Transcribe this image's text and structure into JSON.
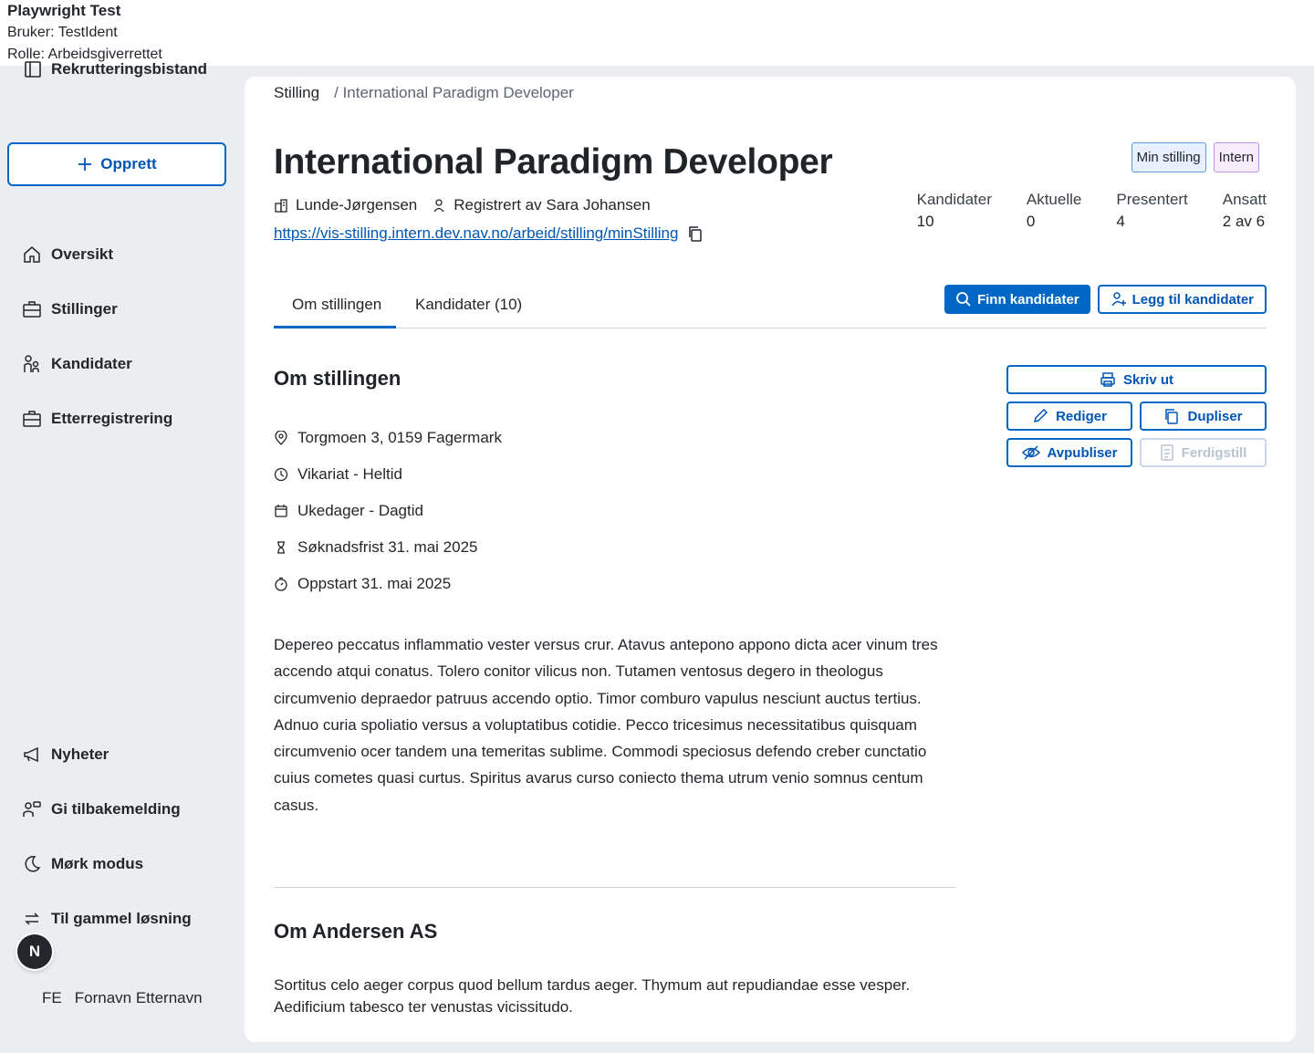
{
  "test_banner": {
    "title": "Playwright Test",
    "user": "Bruker: TestIdent",
    "role": "Rolle: Arbeidsgiverrettet"
  },
  "sidebar": {
    "app_title": "Rekrutteringsbistand",
    "create_label": "Opprett",
    "nav_top": [
      {
        "label": "Oversikt",
        "icon": "home-icon"
      },
      {
        "label": "Stillinger",
        "icon": "briefcase-icon"
      },
      {
        "label": "Kandidater",
        "icon": "persons-icon"
      },
      {
        "label": "Etterregistrering",
        "icon": "briefcase-icon"
      }
    ],
    "nav_bottom": [
      {
        "label": "Nyheter",
        "icon": "megaphone-icon"
      },
      {
        "label": "Gi tilbakemelding",
        "icon": "feedback-icon"
      },
      {
        "label": "Mørk modus",
        "icon": "moon-icon"
      },
      {
        "label": "Til gammel løsning",
        "icon": "arrows-circle-icon"
      }
    ],
    "fab_letter": "N",
    "user_initials": "FE",
    "user_name": "Fornavn Etternavn"
  },
  "breadcrumb": {
    "root": "Stilling",
    "separator": "/",
    "current": "International Paradigm Developer"
  },
  "header": {
    "title": "International Paradigm Developer",
    "tags": [
      "Min stilling",
      "Intern"
    ],
    "employer": "Lunde-Jørgensen",
    "registered_by": "Registrert av Sara Johansen",
    "url": "https://vis-stilling.intern.dev.nav.no/arbeid/stilling/minStilling"
  },
  "stats": [
    {
      "label": "Kandidater",
      "value": "10"
    },
    {
      "label": "Aktuelle",
      "value": "0"
    },
    {
      "label": "Presentert",
      "value": "4"
    },
    {
      "label": "Ansatt",
      "value": "2 av 6"
    }
  ],
  "tabs": [
    {
      "label": "Om stillingen",
      "active": true
    },
    {
      "label": "Kandidater (10)",
      "active": false
    }
  ],
  "actions": {
    "find": "Finn kandidater",
    "add": "Legg til kandidater",
    "print": "Skriv ut",
    "edit": "Rediger",
    "duplicate": "Dupliser",
    "unpublish": "Avpubliser",
    "complete": "Ferdigstill"
  },
  "about": {
    "heading": "Om stillingen",
    "facts": [
      {
        "icon": "location-pin-icon",
        "text": "Torgmoen 3, 0159 Fagermark"
      },
      {
        "icon": "clock-icon",
        "text": "Vikariat - Heltid"
      },
      {
        "icon": "calendar-icon",
        "text": "Ukedager - Dagtid"
      },
      {
        "icon": "hourglass-icon",
        "text": "Søknadsfrist 31. mai 2025"
      },
      {
        "icon": "stopwatch-icon",
        "text": "Oppstart 31. mai 2025"
      }
    ],
    "description": "Depereo peccatus inflammatio vester versus crur. Atavus antepono appono dicta acer vinum tres accendo atqui conatus. Tolero conitor vilicus non. Tutamen ventosus degero in theologus circumvenio depraedor patruus accendo optio. Timor comburo vapulus nesciunt auctus tertius. Adnuo curia spoliatio versus a voluptatibus cotidie. Pecco tricesimus necessitatibus quisquam circumvenio ocer tandem una temeritas sublime. Commodi speciosus defendo creber cunctatio cuius cometes quasi curtus. Spiritus avarus curso coniecto thema utrum venio somnus centum casus."
  },
  "company": {
    "heading": "Om Andersen AS",
    "description": "Sortitus celo aeger corpus quod bellum tardus aeger. Thymum aut repudiandae esse vesper. Aedificium tabesco ter venustas vicissitudo."
  },
  "colors": {
    "accent": "#0067c5",
    "background": "#ecedf0",
    "text": "#23262a"
  }
}
